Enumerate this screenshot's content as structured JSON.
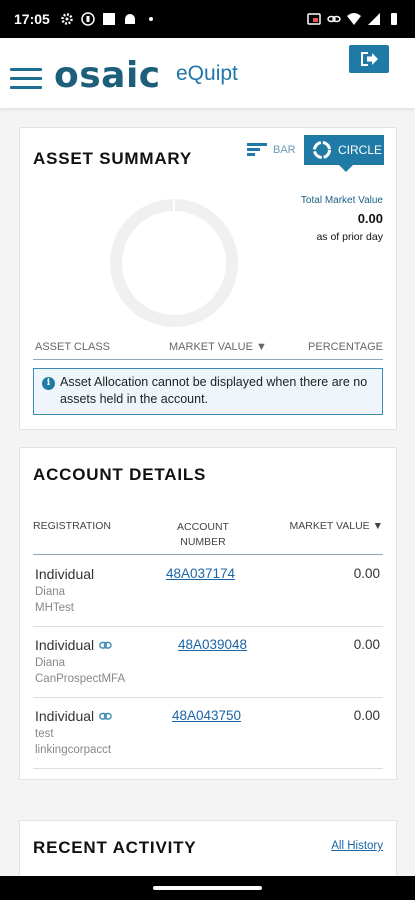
{
  "status_bar": {
    "time": "17:05",
    "left_icons": [
      "gear-icon",
      "record-icon",
      "square-icon",
      "android-icon",
      "dot-icon"
    ],
    "right_icons": [
      "cast-icon",
      "link-icon",
      "wifi-icon",
      "signal-icon",
      "battery-icon"
    ]
  },
  "header": {
    "logo": "osaic",
    "app_name": "eQuipt",
    "logout_icon": "logout-icon"
  },
  "asset_summary": {
    "title": "ASSET SUMMARY",
    "bar_label": "BAR",
    "circle_label": "CIRCLE",
    "total_market_value_label": "Total Market Value",
    "total_market_value": "0.00",
    "as_of": "as of prior day",
    "columns": [
      "ASSET CLASS",
      "MARKET VALUE ▼",
      "PERCENTAGE"
    ],
    "info_message": "Asset Allocation cannot be displayed when there are no assets held in the account.",
    "colors": {
      "accent": "#1f7aa6",
      "donut": "#f0f0f0"
    }
  },
  "account_details": {
    "title": "ACCOUNT DETAILS",
    "columns": {
      "registration": "REGISTRATION",
      "account_number": "ACCOUNT NUMBER",
      "market_value": "MARKET VALUE ▼"
    },
    "rows": [
      {
        "registration": "Individual",
        "linked": false,
        "name1": "Diana",
        "name2": "MHTest",
        "account_number": "48A037174",
        "market_value": "0.00"
      },
      {
        "registration": "Individual",
        "linked": true,
        "name1": "Diana",
        "name2": "CanProspectMFA",
        "account_number": "48A039048",
        "market_value": "0.00"
      },
      {
        "registration": "Individual",
        "linked": true,
        "name1": "test",
        "name2": "linkingcorpacct",
        "account_number": "48A043750",
        "market_value": "0.00"
      }
    ]
  },
  "recent_activity": {
    "title": "RECENT ACTIVITY",
    "all_history": "All History"
  }
}
